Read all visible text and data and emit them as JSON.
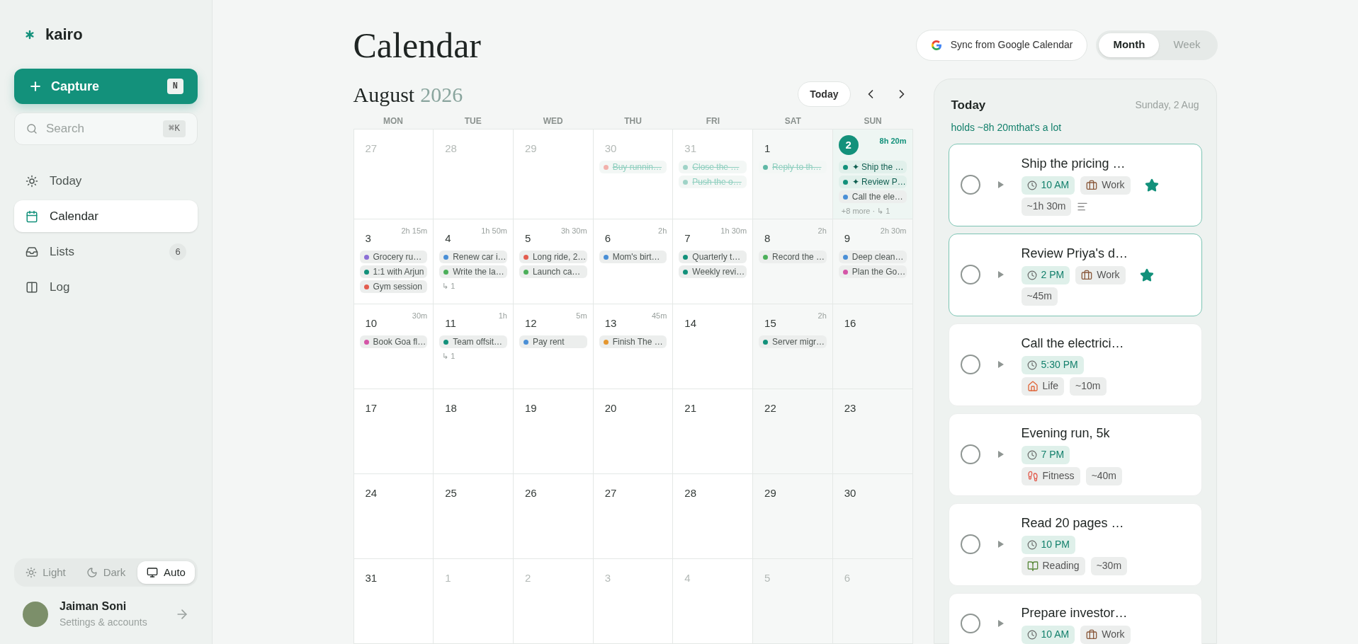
{
  "sidebar": {
    "logo": "kairo",
    "capture": {
      "label": "Capture",
      "shortcut": "N"
    },
    "search": {
      "placeholder": "Search",
      "shortcut": "⌘K"
    },
    "nav": [
      {
        "label": "Today",
        "selected": false
      },
      {
        "label": "Calendar",
        "selected": true
      },
      {
        "label": "Lists",
        "selected": false,
        "badge": "6"
      },
      {
        "label": "Log",
        "selected": false
      }
    ],
    "theme": [
      {
        "label": "Light",
        "selected": false
      },
      {
        "label": "Dark",
        "selected": false
      },
      {
        "label": "Auto",
        "selected": true
      }
    ],
    "user": {
      "name": "Jaiman Soni",
      "subtitle": "Settings & accounts"
    }
  },
  "header": {
    "title": "Calendar",
    "sync": "Sync from Google Calendar",
    "views": [
      {
        "label": "Month",
        "selected": true
      },
      {
        "label": "Week",
        "selected": false
      }
    ]
  },
  "calendar": {
    "month": "August",
    "year": "2026",
    "today_button": "Today",
    "weekdays": [
      "MON",
      "TUE",
      "WED",
      "THU",
      "FRI",
      "SAT",
      "SUN"
    ],
    "weeks": [
      [
        {
          "day": "27",
          "in_month": false,
          "today": false
        },
        {
          "day": "28",
          "in_month": false,
          "today": false
        },
        {
          "day": "29",
          "in_month": false,
          "today": false
        },
        {
          "day": "30",
          "in_month": false,
          "today": false,
          "events": [
            {
              "title": "Buy runnin…",
              "color": "#f2b1ab",
              "done": true,
              "focus": false
            }
          ]
        },
        {
          "day": "31",
          "in_month": false,
          "today": false,
          "events": [
            {
              "title": "Close the …",
              "color": "#9fd3c7",
              "done": true,
              "focus": false
            },
            {
              "title": "Push the o…",
              "color": "#9fd3c7",
              "done": true,
              "focus": false
            }
          ]
        },
        {
          "day": "1",
          "in_month": true,
          "today": false,
          "events": [
            {
              "title": "Reply to th…",
              "color": "#5fb8a5",
              "done": true,
              "focus": false
            }
          ]
        },
        {
          "day": "2",
          "in_month": true,
          "today": true,
          "total": "8h 20m",
          "events": [
            {
              "title": "✦ Ship the …",
              "color": "#13917b",
              "done": false,
              "focus": true
            },
            {
              "title": "✦ Review P…",
              "color": "#13917b",
              "done": false,
              "focus": true
            },
            {
              "title": "Call the ele…",
              "color": "#4a8fd6",
              "done": false,
              "focus": false
            }
          ],
          "more": "+8 more · ↳ 1"
        }
      ],
      [
        {
          "day": "3",
          "in_month": true,
          "today": false,
          "total": "2h 15m",
          "events": [
            {
              "title": "Grocery ru…",
              "color": "#8b6fd6",
              "done": false,
              "focus": false
            },
            {
              "title": "1:1 with Arjun",
              "color": "#13917b",
              "done": false,
              "focus": false
            },
            {
              "title": "Gym session",
              "color": "#e35d4f",
              "done": false,
              "focus": false
            }
          ]
        },
        {
          "day": "4",
          "in_month": true,
          "today": false,
          "total": "1h 50m",
          "events": [
            {
              "title": "Renew car i…",
              "color": "#4a8fd6",
              "done": false,
              "focus": false
            },
            {
              "title": "Write the la…",
              "color": "#4caf5a",
              "done": false,
              "focus": false
            }
          ],
          "more": "↳ 1"
        },
        {
          "day": "5",
          "in_month": true,
          "today": false,
          "total": "3h 30m",
          "events": [
            {
              "title": "Long ride, 2…",
              "color": "#e35d4f",
              "done": false,
              "focus": false
            },
            {
              "title": "Launch ca…",
              "color": "#4caf5a",
              "done": false,
              "focus": false
            }
          ]
        },
        {
          "day": "6",
          "in_month": true,
          "today": false,
          "total": "2h",
          "events": [
            {
              "title": "Mom's birt…",
              "color": "#4a8fd6",
              "done": false,
              "focus": false
            }
          ]
        },
        {
          "day": "7",
          "in_month": true,
          "today": false,
          "total": "1h 30m",
          "events": [
            {
              "title": "Quarterly t…",
              "color": "#13917b",
              "done": false,
              "focus": false
            },
            {
              "title": "Weekly revi…",
              "color": "#13917b",
              "done": false,
              "focus": false
            }
          ]
        },
        {
          "day": "8",
          "in_month": true,
          "today": false,
          "total": "2h",
          "events": [
            {
              "title": "Record the …",
              "color": "#4caf5a",
              "done": false,
              "focus": false
            }
          ]
        },
        {
          "day": "9",
          "in_month": true,
          "today": false,
          "total": "2h 30m",
          "events": [
            {
              "title": "Deep clean…",
              "color": "#4a8fd6",
              "done": false,
              "focus": false
            },
            {
              "title": "Plan the Go…",
              "color": "#d455a7",
              "done": false,
              "focus": false
            }
          ]
        }
      ],
      [
        {
          "day": "10",
          "in_month": true,
          "today": false,
          "total": "30m",
          "events": [
            {
              "title": "Book Goa fl…",
              "color": "#d455a7",
              "done": false,
              "focus": false
            }
          ]
        },
        {
          "day": "11",
          "in_month": true,
          "today": false,
          "total": "1h",
          "events": [
            {
              "title": "Team offsit…",
              "color": "#13917b",
              "done": false,
              "focus": false
            }
          ],
          "more": "↳ 1"
        },
        {
          "day": "12",
          "in_month": true,
          "today": false,
          "total": "5m",
          "events": [
            {
              "title": "Pay rent",
              "color": "#4a8fd6",
              "done": false,
              "focus": false
            }
          ]
        },
        {
          "day": "13",
          "in_month": true,
          "today": false,
          "total": "45m",
          "events": [
            {
              "title": "Finish The …",
              "color": "#e4962f",
              "done": false,
              "focus": false
            }
          ]
        },
        {
          "day": "14",
          "in_month": true,
          "today": false
        },
        {
          "day": "15",
          "in_month": true,
          "today": false,
          "total": "2h",
          "events": [
            {
              "title": "Server migr…",
              "color": "#13917b",
              "done": false,
              "focus": false
            }
          ]
        },
        {
          "day": "16",
          "in_month": true,
          "today": false
        }
      ],
      [
        {
          "day": "17",
          "in_month": true,
          "today": false
        },
        {
          "day": "18",
          "in_month": true,
          "today": false
        },
        {
          "day": "19",
          "in_month": true,
          "today": false
        },
        {
          "day": "20",
          "in_month": true,
          "today": false
        },
        {
          "day": "21",
          "in_month": true,
          "today": false
        },
        {
          "day": "22",
          "in_month": true,
          "today": false
        },
        {
          "day": "23",
          "in_month": true,
          "today": false
        }
      ],
      [
        {
          "day": "24",
          "in_month": true,
          "today": false
        },
        {
          "day": "25",
          "in_month": true,
          "today": false
        },
        {
          "day": "26",
          "in_month": true,
          "today": false
        },
        {
          "day": "27",
          "in_month": true,
          "today": false
        },
        {
          "day": "28",
          "in_month": true,
          "today": false
        },
        {
          "day": "29",
          "in_month": true,
          "today": false
        },
        {
          "day": "30",
          "in_month": true,
          "today": false
        }
      ],
      [
        {
          "day": "31",
          "in_month": true,
          "today": false
        },
        {
          "day": "1",
          "in_month": false,
          "today": false
        },
        {
          "day": "2",
          "in_month": false,
          "today": false
        },
        {
          "day": "3",
          "in_month": false,
          "today": false
        },
        {
          "day": "4",
          "in_month": false,
          "today": false
        },
        {
          "day": "5",
          "in_month": false,
          "today": false
        },
        {
          "day": "6",
          "in_month": false,
          "today": false
        }
      ]
    ]
  },
  "today_panel": {
    "title": "Today",
    "date": "Sunday, 2 Aug",
    "summary": "holds ~8h 20mthat's a lot",
    "tasks": [
      {
        "title": "Ship the pricing …",
        "starred": true,
        "chip_rows": [
          [
            {
              "kind": "time",
              "label": "10 AM"
            },
            {
              "kind": "work",
              "label": "Work"
            }
          ],
          [
            {
              "kind": "duration",
              "label": "~1h 30m"
            },
            {
              "kind": "notes"
            }
          ]
        ]
      },
      {
        "title": "Review Priya's d…",
        "starred": true,
        "chip_rows": [
          [
            {
              "kind": "time",
              "label": "2 PM"
            },
            {
              "kind": "work",
              "label": "Work"
            }
          ],
          [
            {
              "kind": "duration",
              "label": "~45m"
            }
          ]
        ]
      },
      {
        "title": "Call the electrici…",
        "starred": false,
        "chip_rows": [
          [
            {
              "kind": "time",
              "label": "5:30 PM"
            }
          ],
          [
            {
              "kind": "life",
              "label": "Life"
            },
            {
              "kind": "duration",
              "label": "~10m"
            }
          ]
        ]
      },
      {
        "title": "Evening run, 5k",
        "starred": false,
        "chip_rows": [
          [
            {
              "kind": "time",
              "label": "7 PM"
            }
          ],
          [
            {
              "kind": "fitness",
              "label": "Fitness"
            },
            {
              "kind": "duration",
              "label": "~40m"
            }
          ]
        ]
      },
      {
        "title": "Read 20 pages …",
        "starred": false,
        "chip_rows": [
          [
            {
              "kind": "time",
              "label": "10 PM"
            }
          ],
          [
            {
              "kind": "reading",
              "label": "Reading"
            },
            {
              "kind": "duration",
              "label": "~30m"
            }
          ]
        ]
      },
      {
        "title": "Prepare investor…",
        "starred": false,
        "chip_rows": [
          [
            {
              "kind": "time",
              "label": "10 AM"
            },
            {
              "kind": "work",
              "label": "Work"
            }
          ]
        ]
      }
    ]
  }
}
